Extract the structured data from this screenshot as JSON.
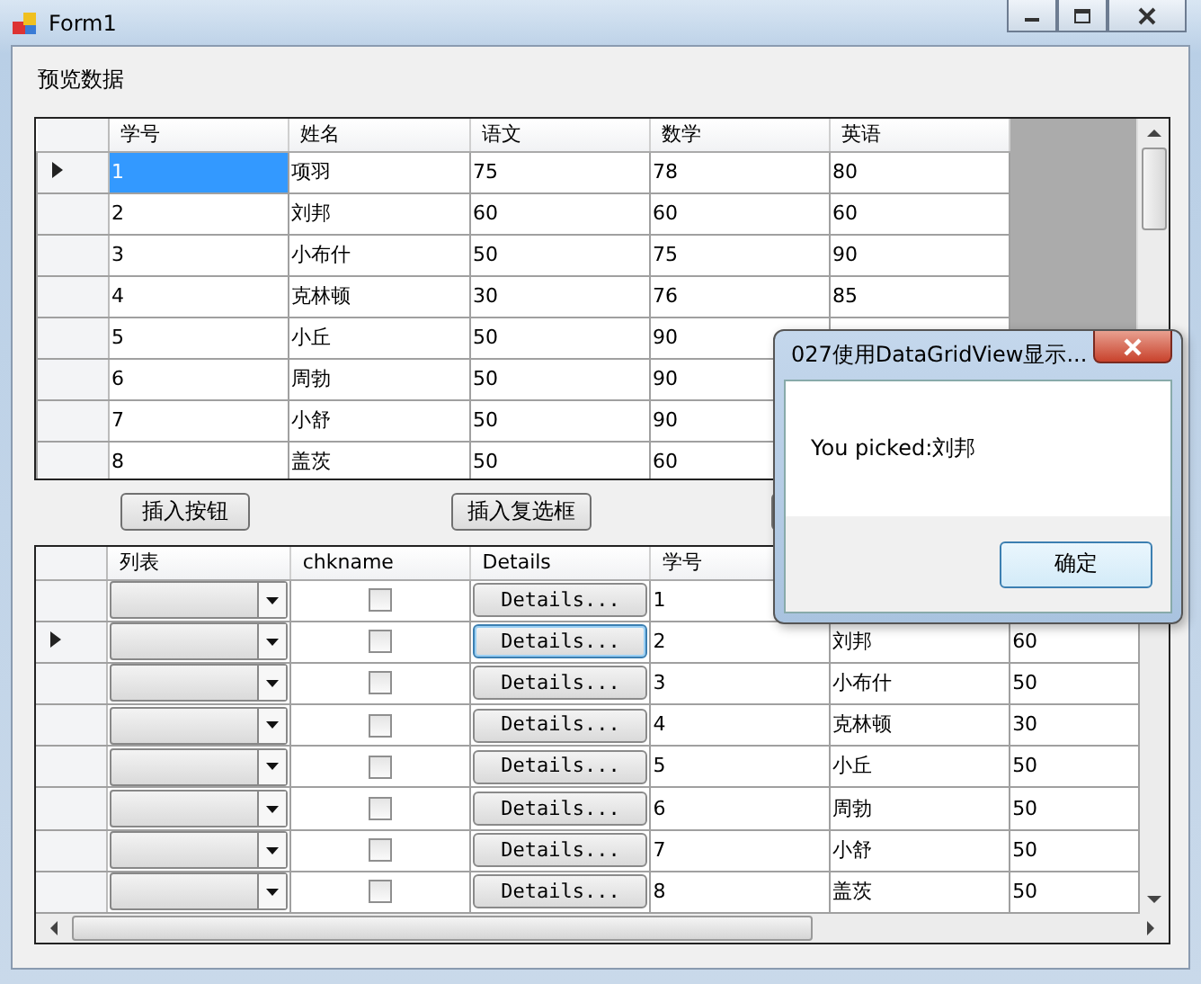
{
  "window": {
    "title": "Form1"
  },
  "preview_label": "预览数据",
  "upper_grid": {
    "columns": [
      "学号",
      "姓名",
      "语文",
      "数学",
      "英语"
    ],
    "rows": [
      {
        "selected": true,
        "cells": [
          "1",
          "项羽",
          "75",
          "78",
          "80"
        ]
      },
      {
        "selected": false,
        "cells": [
          "2",
          "刘邦",
          "60",
          "60",
          "60"
        ]
      },
      {
        "selected": false,
        "cells": [
          "3",
          "小布什",
          "50",
          "75",
          "90"
        ]
      },
      {
        "selected": false,
        "cells": [
          "4",
          "克林顿",
          "30",
          "76",
          "85"
        ]
      },
      {
        "selected": false,
        "cells": [
          "5",
          "小丘",
          "50",
          "90"
        ]
      },
      {
        "selected": false,
        "cells": [
          "6",
          "周勃",
          "50",
          "90"
        ]
      },
      {
        "selected": false,
        "cells": [
          "7",
          "小舒",
          "50",
          "90"
        ]
      },
      {
        "selected": false,
        "cells": [
          "8",
          "盖茨",
          "50",
          "60"
        ]
      }
    ]
  },
  "buttons": [
    {
      "label": "插入按钮"
    },
    {
      "label": "插入复选框"
    }
  ],
  "lower_grid": {
    "columns": [
      "列表",
      "chkname",
      "Details",
      "学号"
    ],
    "rows": [
      {
        "selected": false,
        "checked": false,
        "button": "Details...",
        "cells": [
          "1"
        ]
      },
      {
        "selected": true,
        "checked": false,
        "button": "Details...",
        "cells": [
          "2",
          "刘邦",
          "60"
        ]
      },
      {
        "selected": false,
        "checked": false,
        "button": "Details...",
        "cells": [
          "3",
          "小布什",
          "50"
        ]
      },
      {
        "selected": false,
        "checked": false,
        "button": "Details...",
        "cells": [
          "4",
          "克林顿",
          "30"
        ]
      },
      {
        "selected": false,
        "checked": false,
        "button": "Details...",
        "cells": [
          "5",
          "小丘",
          "50"
        ]
      },
      {
        "selected": false,
        "checked": false,
        "button": "Details...",
        "cells": [
          "6",
          "周勃",
          "50"
        ]
      },
      {
        "selected": false,
        "checked": false,
        "button": "Details...",
        "cells": [
          "7",
          "小舒",
          "50"
        ]
      },
      {
        "selected": false,
        "checked": false,
        "button": "Details...",
        "cells": [
          "8",
          "盖茨",
          "50"
        ]
      }
    ]
  },
  "dialog": {
    "title": "027使用DataGridView显示...",
    "message": "You picked:刘邦",
    "ok": "确定"
  }
}
